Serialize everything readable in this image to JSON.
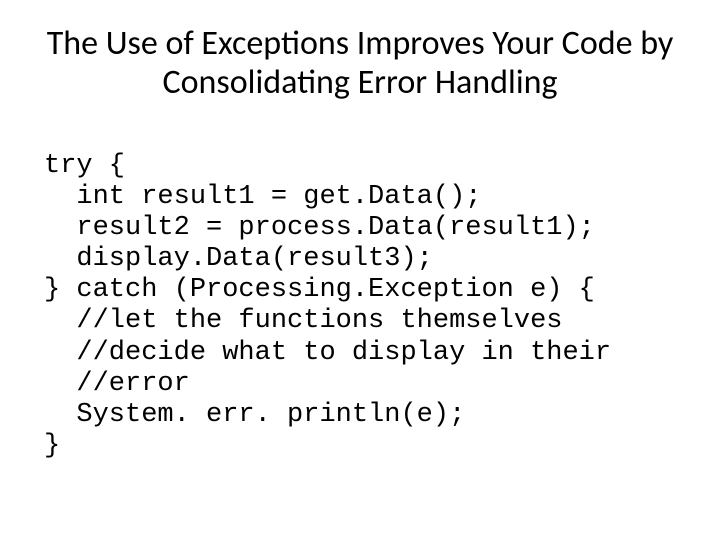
{
  "title": "The Use of Exceptions Improves Your Code by Consolidating Error Handling",
  "code": {
    "l0": "try {",
    "l1": "  int result1 = get.Data();",
    "l2": "  result2 = process.Data(result1);",
    "l3": "  display.Data(result3);",
    "l4": "} catch (Processing.Exception e) {",
    "l5": "  //let the functions themselves",
    "l6": "  //decide what to display in their",
    "l7": "  //error",
    "l8": "  System. err. println(e);",
    "l9": "}"
  }
}
